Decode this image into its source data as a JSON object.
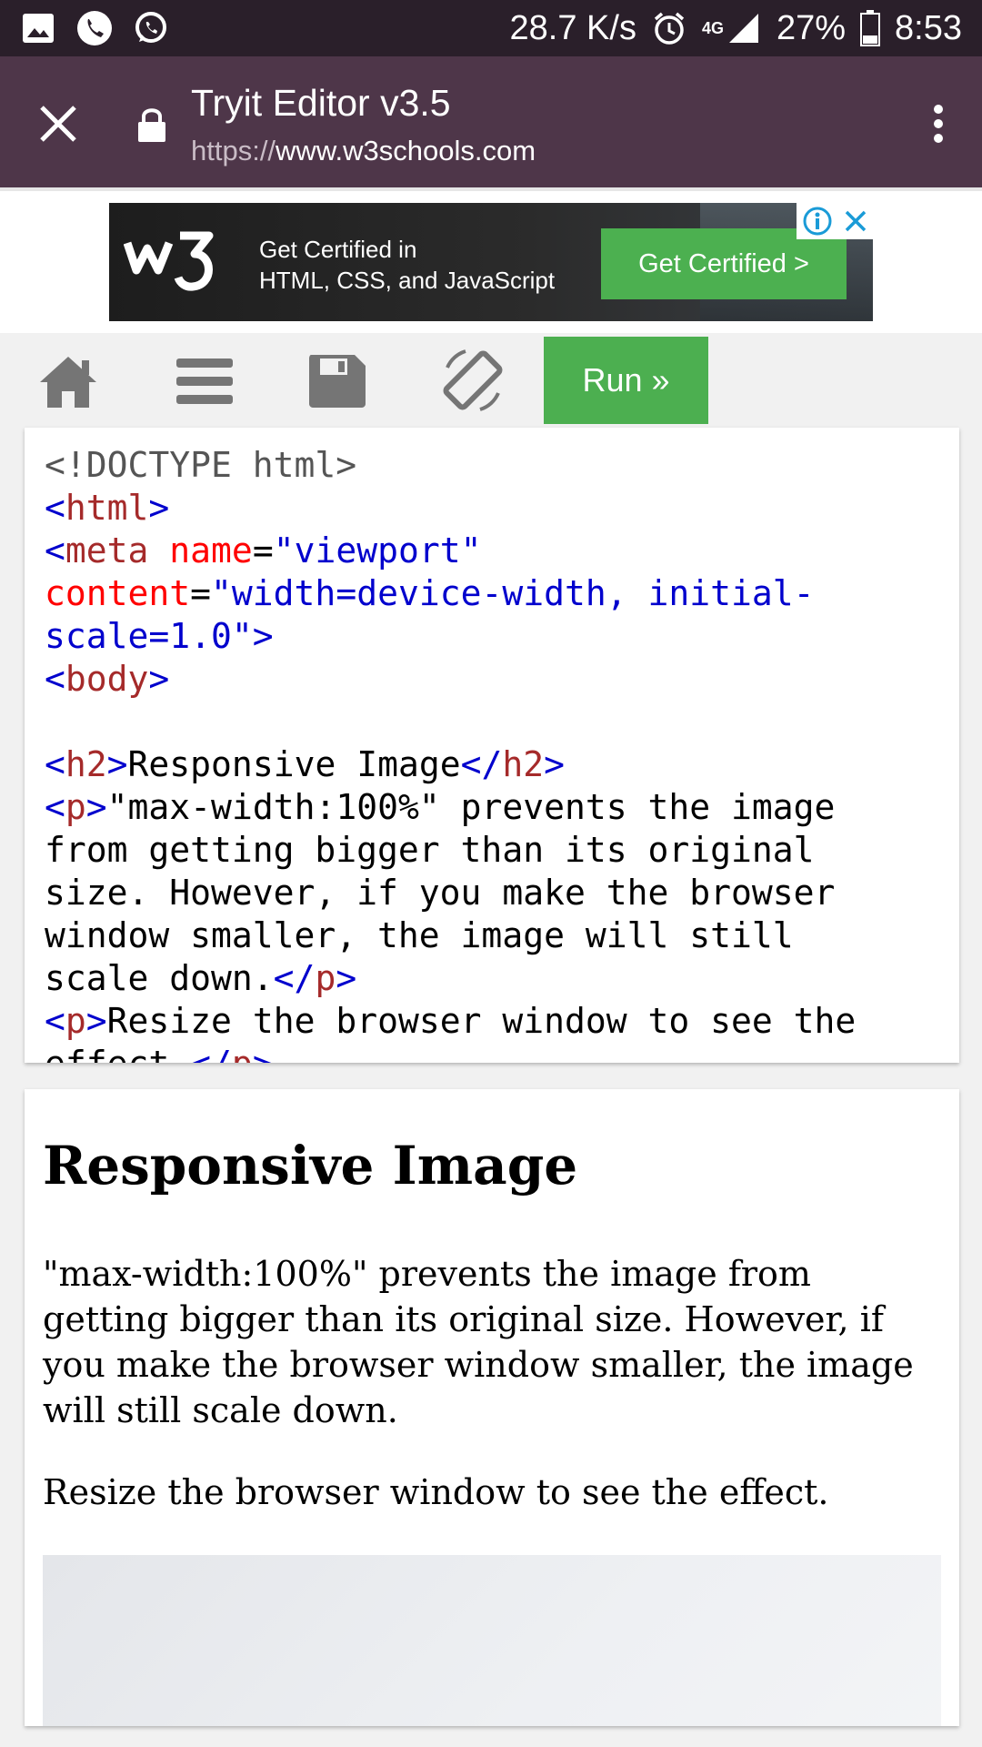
{
  "status_bar": {
    "speed": "28.7 K/s",
    "network": "4G",
    "battery": "27%",
    "time": "8:53",
    "icons": [
      "image-icon",
      "phone-icon",
      "whatsapp-icon",
      "alarm-icon",
      "signal-icon",
      "battery-icon"
    ]
  },
  "browser": {
    "title": "Tryit Editor v3.5",
    "url_protocol": "https://",
    "url_host": "www.w3schools.com"
  },
  "ad": {
    "line1": "Get Certified in",
    "line2": "HTML, CSS, and JavaScript",
    "button": "Get Certified >"
  },
  "toolbar": {
    "run_label": "Run »",
    "icons": [
      "home-icon",
      "menu-icon",
      "save-icon",
      "rotate-icon"
    ]
  },
  "code_editor": {
    "l1": "<!DOCTYPE html>",
    "l2_tag": "html",
    "l3_tag": "meta",
    "l3_attr": "name",
    "l3_val": "\"viewport\"",
    "l4_attr": "content",
    "l4_val": "\"width=device-width, initial-",
    "l5_val": "scale=1.0\"",
    "l6_tag": "body",
    "l8_tag": "h2",
    "l8_text": "Responsive Image",
    "l9_tag": "p",
    "l9_text": "\"max-width:100%\" prevents the image",
    "l10_text": "from getting bigger than its original",
    "l11_text": "size. However, if you make the browser",
    "l12_text": "window smaller, the image will still",
    "l13_text": "scale down.",
    "l14_tag": "p",
    "l14_text": "Resize the browser window to see the",
    "l15_text": "effect."
  },
  "result": {
    "heading": "Responsive Image",
    "paragraph1": "\"max-width:100%\" prevents the image from getting bigger than its original size. However, if you make the browser window smaller, the image will still scale down.",
    "paragraph2": "Resize the browser window to see the effect."
  },
  "colors": {
    "status_bar": "#2a1f2a",
    "browser_bar": "#4e3649",
    "run_button": "#4caf50",
    "code_tag": "#a52a2a",
    "code_bracket": "#0000cd",
    "code_attr": "#ff0000"
  }
}
